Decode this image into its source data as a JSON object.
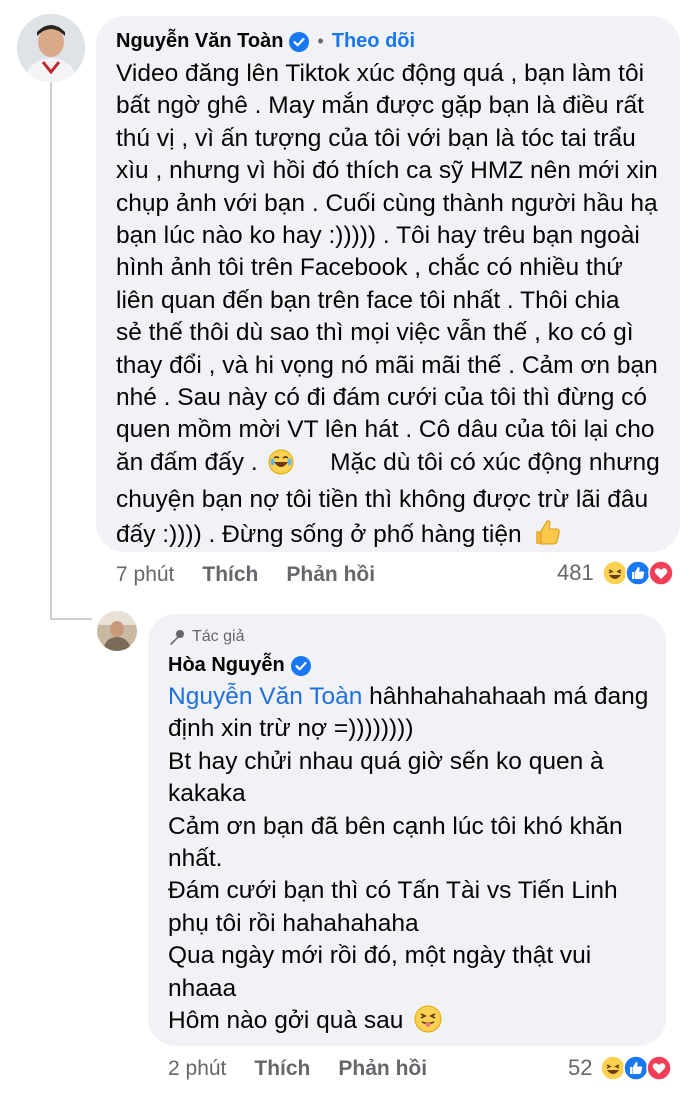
{
  "comment1": {
    "author": "Nguyễn Văn Toàn",
    "follow_label": "Theo dõi",
    "separator": "•",
    "lines": [
      "Video đăng lên Tiktok xúc động quá , bạn làm tôi",
      "bất ngờ ghê . May mắn được gặp bạn là điều rất",
      "thú vị , vì ấn tượng của tôi với bạn là tóc tai trẩu",
      "xìu , nhưng vì hồi đó thích ca sỹ HMZ nên mới xin",
      "chụp ảnh với bạn . Cuối cùng thành người hầu hạ",
      "bạn lúc nào ko hay :))))) . Tôi hay trêu bạn ngoài",
      "hình ảnh tôi trên Facebook , chắc có nhiều thứ",
      "liên quan đến bạn trên face tôi nhất . Thôi chia",
      "sẻ thế thôi dù sao thì mọi việc vẫn thế , ko có gì",
      "thay đổi , và hi vọng nó mãi mãi thế . Cảm ơn bạn",
      "nhé . Sau này có đi đám cưới của tôi thì đừng có",
      "quen mồm mời VT lên hát . Cô dâu của tôi lại cho"
    ],
    "line12_text": "ăn đấm đấy .",
    "line12_after": "Mặc dù tôi có xúc động nhưng",
    "line13": "chuyện bạn nợ tôi tiền thì không được trừ lãi đâu",
    "line14_text": "đấy :)))) . Đừng sống ở phố hàng tiện",
    "emoji_laugh": "laughing-tears-emoji",
    "emoji_thumb": "thumbs-up-emoji",
    "time": "7 phút",
    "like_label": "Thích",
    "reply_label": "Phản hồi",
    "reaction_count": "481",
    "reaction_icons": [
      "haha-icon",
      "like-icon",
      "love-icon"
    ]
  },
  "reply1": {
    "badge_label": "Tác giả",
    "author": "Hòa Nguyễn",
    "mention": "Nguyễn Văn Toàn",
    "line1_after": " hâhhahahahaah má đang",
    "lines": [
      "định xin trừ nợ =))))))))",
      "Bt hay chửi nhau quá giờ sến ko quen à",
      "kakaka",
      "Cảm ơn bạn đã bên cạnh lúc tôi khó khăn",
      "nhất.",
      "Đám cưới bạn thì có Tấn Tài vs Tiến Linh",
      "phụ tôi rồi hahahahaha",
      "Qua ngày mới rồi đó, một ngày thật vui",
      "nhaaa"
    ],
    "last_line_text": "Hôm nào gởi quà sau",
    "emoji_tongue": "squinting-tongue-emoji",
    "time": "2 phút",
    "like_label": "Thích",
    "reply_label": "Phản hồi",
    "reaction_count": "52",
    "reaction_icons": [
      "haha-icon",
      "like-icon",
      "love-icon"
    ]
  },
  "colors": {
    "bubble_bg": "#f0f2f5",
    "link_blue": "#1877f2",
    "muted": "#65676b",
    "love_red": "#f33e58",
    "haha_yellow": "#fcd050"
  }
}
